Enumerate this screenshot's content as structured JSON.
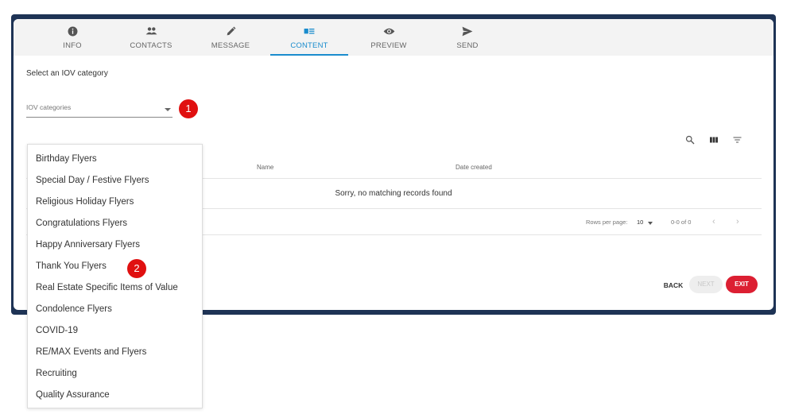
{
  "tabs": [
    {
      "label": "INFO",
      "icon": "info-icon",
      "active": false
    },
    {
      "label": "CONTACTS",
      "icon": "contacts-icon",
      "active": false
    },
    {
      "label": "MESSAGE",
      "icon": "pencil-icon",
      "active": false
    },
    {
      "label": "CONTENT",
      "icon": "content-icon",
      "active": true
    },
    {
      "label": "PREVIEW",
      "icon": "eye-icon",
      "active": false
    },
    {
      "label": "SEND",
      "icon": "send-icon",
      "active": false
    }
  ],
  "content": {
    "prompt": "Select an IOV category",
    "select_placeholder": "IOV categories"
  },
  "annotations": {
    "first": "1",
    "second": "2"
  },
  "table": {
    "columns": [
      "Name",
      "Date created"
    ],
    "empty_message": "Sorry, no matching records found",
    "rows_per_page_label": "Rows per page:",
    "rows_per_page_value": "10",
    "range": "0-0 of 0"
  },
  "footer": {
    "back": "BACK",
    "next": "NEXT",
    "exit": "EXIT"
  },
  "dropdown": {
    "options": [
      "Birthday Flyers",
      "Special Day / Festive Flyers",
      "Religious Holiday Flyers",
      "Congratulations Flyers",
      "Happy Anniversary Flyers",
      "Thank You Flyers",
      "Real Estate Specific Items of Value",
      "Condolence Flyers",
      "COVID-19",
      "RE/MAX Events and Flyers",
      "Recruiting",
      "Quality Assurance"
    ]
  },
  "colors": {
    "frame": "#1e3355",
    "accent": "#1a8ccd",
    "exit": "#dc1f32",
    "badge": "#e01010"
  }
}
